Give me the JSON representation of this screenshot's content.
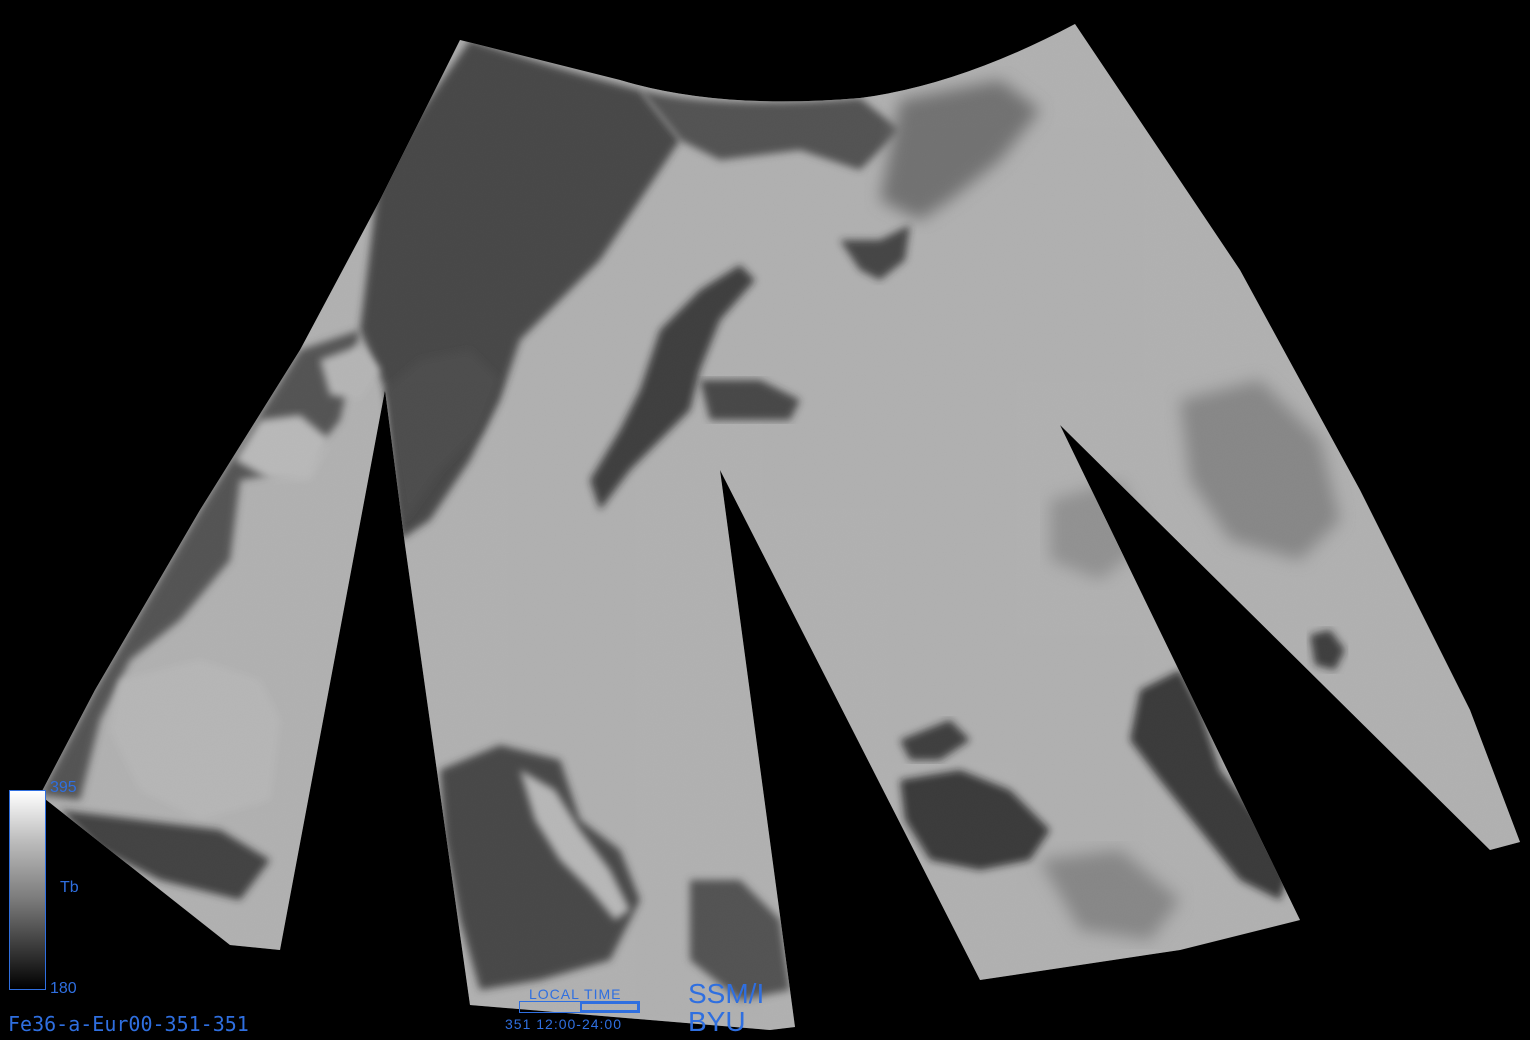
{
  "image": {
    "file_id": "Fe36-a-Eur00-351-351",
    "sensor": "SSM/I",
    "organization": "BYU"
  },
  "colorbar": {
    "max_label": "395",
    "min_label": "180",
    "unit_label": "Tb",
    "accent_color": "#2f6fe0"
  },
  "time_indicator": {
    "title": "LOCAL  TIME",
    "caption": "351  12:00-24:00",
    "filled_fraction_start": 0.5,
    "filled_fraction_end": 1.0
  }
}
